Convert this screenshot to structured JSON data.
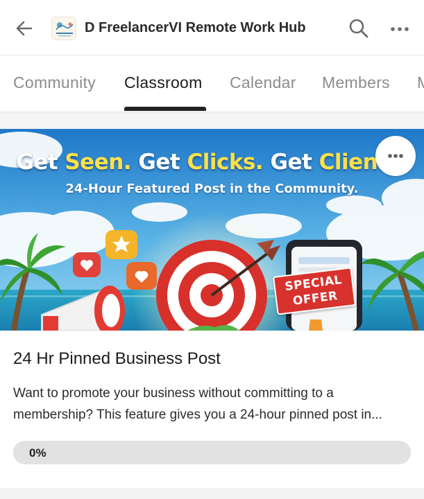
{
  "header": {
    "group_title": "D FreelancerVI Remote Work Hub",
    "icons": {
      "back": "arrow-left-icon",
      "search": "search-icon",
      "more": "more-horizontal-icon"
    }
  },
  "tabs": [
    {
      "label": "Community",
      "active": false
    },
    {
      "label": "Classroom",
      "active": true
    },
    {
      "label": "Calendar",
      "active": false
    },
    {
      "label": "Members",
      "active": false
    },
    {
      "label": "M",
      "active": false
    }
  ],
  "course": {
    "banner": {
      "headline_parts": [
        "Get ",
        "Seen.",
        " Get ",
        "Clicks.",
        " Get ",
        "Clients."
      ],
      "subheadline": "24-Hour Featured Post in the Community.",
      "badge_line1": "SPECIAL",
      "badge_line2": "OFFER"
    },
    "title": "24 Hr Pinned Business Post",
    "description": "Want to promote your business without committing to a membership? This feature gives you a 24-hour pinned post in...",
    "progress_label": "0%",
    "progress_value": 0
  },
  "colors": {
    "accent_dark": "#232323",
    "tab_inactive": "#8c8c8c",
    "banner_highlight": "#ffe04a",
    "offer_red": "#d8322e"
  }
}
